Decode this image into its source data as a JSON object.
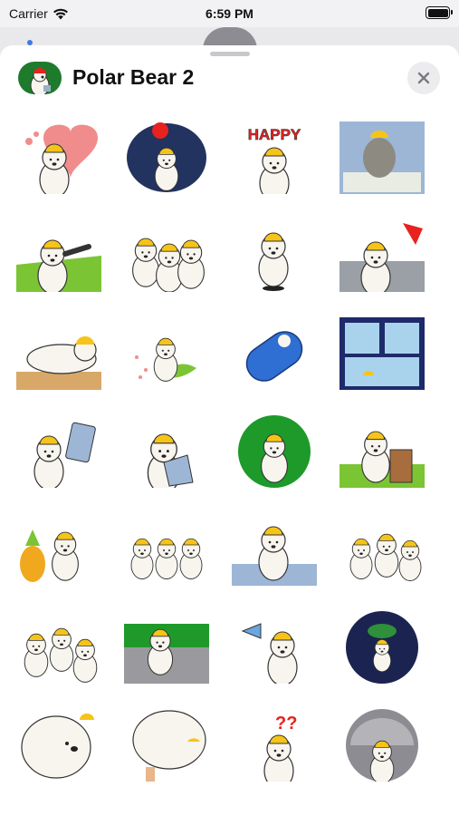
{
  "status_bar": {
    "carrier": "Carrier",
    "time": "6:59 PM"
  },
  "sheet": {
    "title": "Polar Bear 2",
    "close_icon": "close-icon"
  },
  "stickers": [
    {
      "name": "heart-bear",
      "theme": "heart"
    },
    {
      "name": "balloon-bear",
      "theme": "navy-balloon"
    },
    {
      "name": "happy-bear",
      "theme": "happy-text"
    },
    {
      "name": "money-sad-bear",
      "theme": "money"
    },
    {
      "name": "pointing-bear",
      "theme": "grass"
    },
    {
      "name": "three-bears",
      "theme": "group"
    },
    {
      "name": "tumbling-bear",
      "theme": "hole"
    },
    {
      "name": "windy-bear",
      "theme": "wind"
    },
    {
      "name": "desk-bear",
      "theme": "desk"
    },
    {
      "name": "petals-bear",
      "theme": "petals"
    },
    {
      "name": "sleeping-bag-bear",
      "theme": "blue-bag"
    },
    {
      "name": "window-bear",
      "theme": "window"
    },
    {
      "name": "tablet-bear",
      "theme": "tablet"
    },
    {
      "name": "shirt-bear",
      "theme": "shirt"
    },
    {
      "name": "green-frame-bear",
      "theme": "green-circle"
    },
    {
      "name": "stump-bear",
      "theme": "stump"
    },
    {
      "name": "pineapple-bear",
      "theme": "pineapple"
    },
    {
      "name": "dancing-bears",
      "theme": "dance"
    },
    {
      "name": "table-bear",
      "theme": "table"
    },
    {
      "name": "falling-bears",
      "theme": "falling"
    },
    {
      "name": "cheering-bears",
      "theme": "cheer"
    },
    {
      "name": "segway-bear",
      "theme": "segway"
    },
    {
      "name": "megaphone-bear",
      "theme": "megaphone"
    },
    {
      "name": "space-bear",
      "theme": "space"
    },
    {
      "name": "round-bear",
      "theme": "round"
    },
    {
      "name": "tree-bear",
      "theme": "tree"
    },
    {
      "name": "question-bear",
      "theme": "question"
    },
    {
      "name": "helmet-bear",
      "theme": "helmet"
    }
  ],
  "sticker_text": {
    "happy": "HAPPY"
  },
  "colors": {
    "helmet": "#f6c419",
    "grass": "#7bc534",
    "navy": "#22335f",
    "heart": "#f08c8c",
    "blue": "#2f6ed3"
  }
}
